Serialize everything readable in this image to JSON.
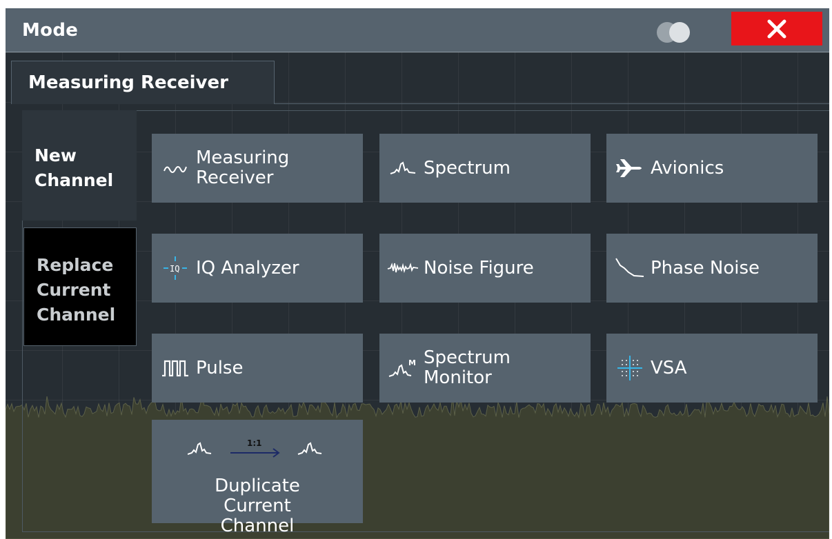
{
  "dialog": {
    "title": "Mode",
    "tab_label": "Measuring Receiver"
  },
  "options": {
    "new_channel": "New Channel",
    "replace_channel": "Replace Current Channel"
  },
  "apps": [
    {
      "label": "Measuring Receiver",
      "icon": "sine-wave-icon"
    },
    {
      "label": "Spectrum",
      "icon": "spectrum-peak-icon"
    },
    {
      "label": "Avionics",
      "icon": "airplane-icon"
    },
    {
      "label": "IQ Analyzer",
      "icon": "iq-crosshair-icon"
    },
    {
      "label": "Noise Figure",
      "icon": "noise-waveform-icon"
    },
    {
      "label": "Phase Noise",
      "icon": "phase-noise-curve-icon"
    },
    {
      "label": "Pulse",
      "icon": "pulse-train-icon"
    },
    {
      "label": "Spectrum Monitor",
      "icon": "spectrum-monitor-icon"
    },
    {
      "label": "VSA",
      "icon": "constellation-grid-icon"
    }
  ],
  "duplicate": {
    "label": "Duplicate Current Channel",
    "ratio_label": "1:1",
    "icon": "duplicate-channel-icon"
  },
  "colors": {
    "titlebar": "#56636e",
    "close": "#e8151a",
    "tile": "#56636e",
    "background": "#262d33",
    "noise": "#3c4030"
  }
}
